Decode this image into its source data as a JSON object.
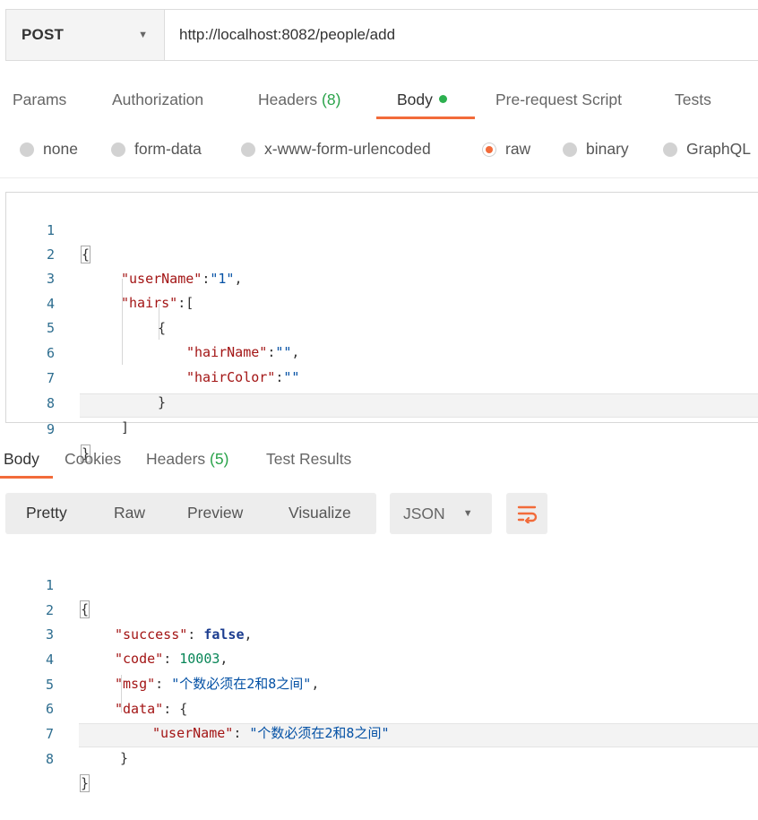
{
  "request": {
    "method": "POST",
    "url": "http://localhost:8082/people/add"
  },
  "tabs": {
    "params": "Params",
    "authorization": "Authorization",
    "headers_label": "Headers",
    "headers_count": "(8)",
    "body": "Body",
    "prerequest": "Pre-request Script",
    "tests": "Tests"
  },
  "body_types": {
    "none": "none",
    "form_data": "form-data",
    "urlencoded": "x-www-form-urlencoded",
    "raw": "raw",
    "binary": "binary",
    "graphql": "GraphQL",
    "selected": "raw"
  },
  "request_body": {
    "line_numbers": [
      "1",
      "2",
      "3",
      "4",
      "5",
      "6",
      "7",
      "8",
      "9"
    ],
    "l1_brace": "{",
    "l2_key": "\"userName\"",
    "l2_colon": ":",
    "l2_value": "\"1\"",
    "l2_comma": ",",
    "l3_key": "\"hairs\"",
    "l3_rest": ":[",
    "l4": "{",
    "l5_key": "\"hairName\"",
    "l5_colon": ":",
    "l5_value": "\"\"",
    "l5_comma": ",",
    "l6_key": "\"hairColor\"",
    "l6_colon": ":",
    "l6_value": "\"\"",
    "l7": "}",
    "l8": "]",
    "l9_brace": "}"
  },
  "response_tabs": {
    "body": "Body",
    "cookies": "Cookies",
    "headers_label": "Headers",
    "headers_count": "(5)",
    "test_results": "Test Results"
  },
  "response_view": {
    "pretty": "Pretty",
    "raw": "Raw",
    "preview": "Preview",
    "visualize": "Visualize",
    "format": "JSON"
  },
  "response_body": {
    "line_numbers": [
      "1",
      "2",
      "3",
      "4",
      "5",
      "6",
      "7",
      "8"
    ],
    "l1": "{",
    "l2_key": "\"success\"",
    "l2_colon": ": ",
    "l2_value": "false",
    "l2_comma": ",",
    "l3_key": "\"code\"",
    "l3_colon": ": ",
    "l3_value": "10003",
    "l3_comma": ",",
    "l4_key": "\"msg\"",
    "l4_colon": ": ",
    "l4_value": "\"个数必须在2和8之间\"",
    "l4_comma": ",",
    "l5_key": "\"data\"",
    "l5_rest": ": {",
    "l6_key": "\"userName\"",
    "l6_colon": ": ",
    "l6_value": "\"个数必须在2和8之间\"",
    "l7": "}",
    "l8": "}"
  },
  "colors": {
    "accent": "#f26b3a",
    "success": "#2cb04f",
    "count": "#2aa34a"
  },
  "icons": {
    "method_caret": "caret-down-icon",
    "format_caret": "caret-down-icon",
    "wrap": "wrap-lines-icon",
    "status_dot": "body-modified-dot"
  }
}
